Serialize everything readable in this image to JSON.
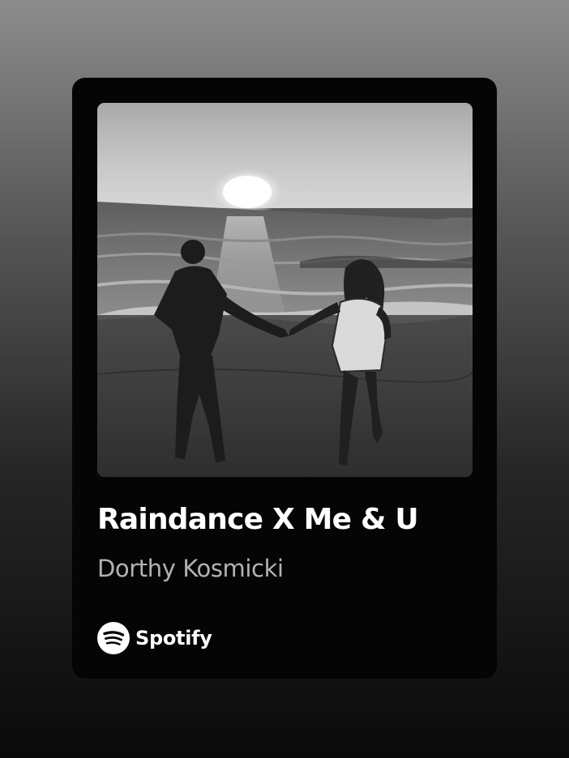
{
  "track": {
    "title": "Raindance X Me & U",
    "artist": "Dorthy Kosmicki"
  },
  "artwork": {
    "alt": "Black and white photo of a couple holding hands on a beach at sunset"
  },
  "brand": {
    "name": "Spotify",
    "icon": "spotify-logo-icon"
  },
  "colors": {
    "card_background": "#050505",
    "title": "#ffffff",
    "artist": "#b3b3b3"
  }
}
